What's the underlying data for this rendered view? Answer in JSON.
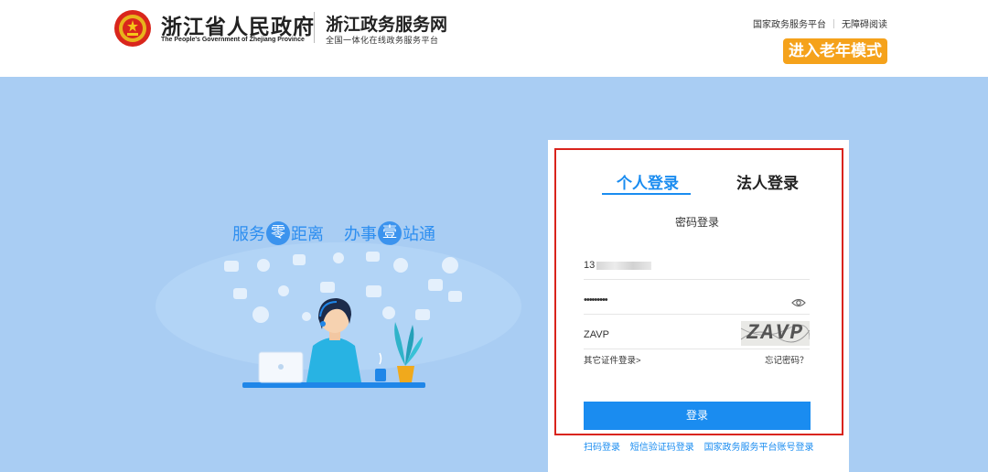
{
  "header": {
    "gov_name_cn": "浙江省人民政府",
    "gov_name_en": "The People's Government of Zhejiang Province",
    "service_name": "浙江政务服务网",
    "service_sub": "全国一体化在线政务服务平台",
    "links": [
      "国家政务服务平台",
      "无障碍阅读"
    ],
    "elder_mode": "进入老年模式"
  },
  "banner": {
    "slogan": [
      "服务",
      "零",
      "距离",
      "办事",
      "壹",
      "站通"
    ]
  },
  "login": {
    "tabs": [
      "个人登录",
      "法人登录"
    ],
    "mode_title": "密码登录",
    "phone_value": "13",
    "password_value": "•••••••••",
    "captcha_value": "ZAVP",
    "captcha_image_text": "ZAVP",
    "other_cert": "其它证件登录>",
    "forgot": "忘记密码？",
    "submit": "登录",
    "alt_methods": [
      "扫码登录",
      "短信验证码登录",
      "国家政务服务平台账号登录"
    ]
  },
  "colors": {
    "accent": "#1a8cf0",
    "elder": "#f5a21b",
    "bg": "#a9cdf3",
    "highlight": "#d9241c"
  }
}
